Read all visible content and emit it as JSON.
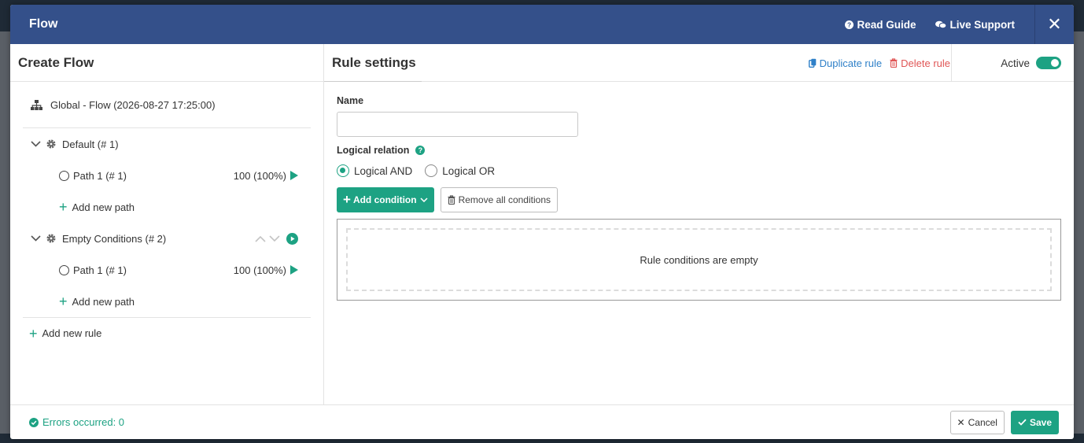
{
  "modal": {
    "title": "Flow"
  },
  "header_links": {
    "read_guide": "Read Guide",
    "live_support": "Live Support"
  },
  "left_panel": {
    "title": "Create Flow",
    "global": "Global - Flow (2026-08-27 17:25:00)",
    "rules": [
      {
        "label": "Default (# 1)",
        "paths": [
          {
            "label": "Path 1 (# 1)",
            "value": "100 (100%)"
          }
        ],
        "add_path": "Add new path"
      },
      {
        "label": "Empty Conditions (# 2)",
        "paths": [
          {
            "label": "Path 1 (# 1)",
            "value": "100 (100%)"
          }
        ],
        "add_path": "Add new path"
      }
    ],
    "add_rule": "Add new rule"
  },
  "rule_settings": {
    "title": "Rule settings",
    "duplicate": "Duplicate rule",
    "delete": "Delete rule",
    "active_label": "Active",
    "active": true,
    "name_label": "Name",
    "name_value": "",
    "logical_relation_label": "Logical relation",
    "help_glyph": "?",
    "options": [
      "Logical AND",
      "Logical OR"
    ],
    "selected_option": "Logical AND",
    "add_condition": "Add condition",
    "remove_all": "Remove all conditions",
    "empty_message": "Rule conditions are empty"
  },
  "footer": {
    "errors": "Errors occurred: 0",
    "cancel": "Cancel",
    "save": "Save"
  },
  "colors": {
    "header": "#34508a",
    "accent": "#1da283",
    "link": "#2f80c8",
    "danger": "#e05656"
  }
}
